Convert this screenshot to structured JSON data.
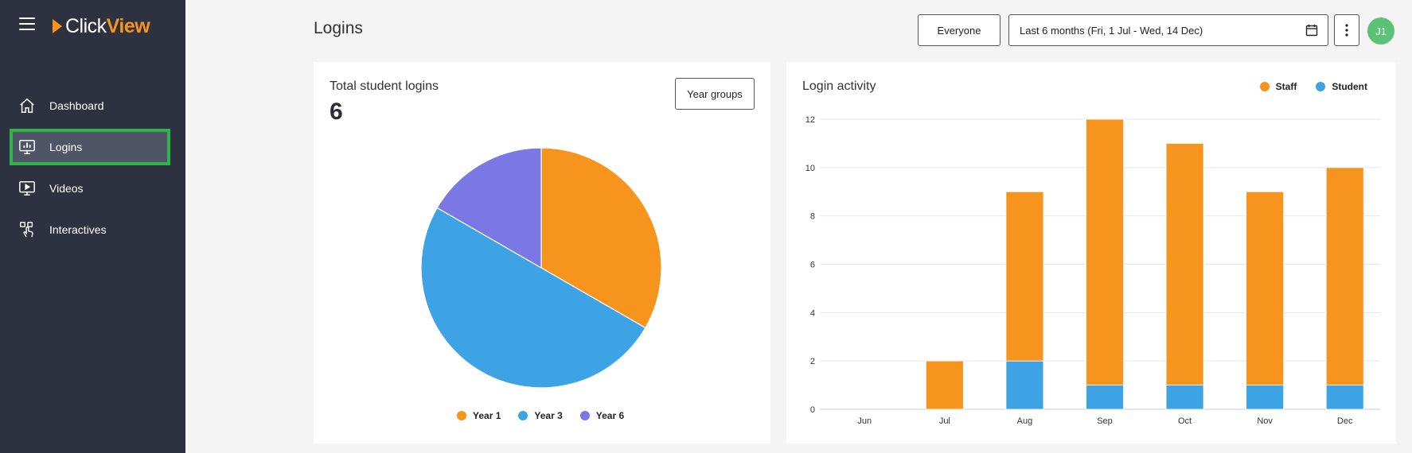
{
  "app": {
    "logo_click": "Click",
    "logo_view": "View"
  },
  "sidebar": {
    "items": [
      {
        "label": "Dashboard",
        "icon": "home-icon"
      },
      {
        "label": "Logins",
        "icon": "monitor-chart-icon",
        "active": true
      },
      {
        "label": "Videos",
        "icon": "video-play-icon"
      },
      {
        "label": "Interactives",
        "icon": "touch-hand-icon"
      }
    ]
  },
  "header": {
    "title": "Logins",
    "audience_label": "Everyone",
    "date_range": "Last 6 months (Fri, 1 Jul - Wed, 14 Dec)",
    "avatar_initials": "J1"
  },
  "colors": {
    "staff": "#f7941d",
    "student": "#3ea3e5",
    "year1": "#f7941d",
    "year3": "#3ea3e5",
    "year6": "#7b77e5",
    "active_outline": "#2fb34a"
  },
  "total_logins": {
    "title": "Total student logins",
    "value": "6",
    "button_label": "Year groups"
  },
  "login_activity": {
    "title": "Login activity"
  },
  "chart_data": [
    {
      "type": "pie",
      "title": "Total student logins",
      "categories": [
        "Year 1",
        "Year 3",
        "Year 6"
      ],
      "values": [
        2,
        3,
        1
      ],
      "legend": "bottom"
    },
    {
      "type": "bar",
      "stacked": true,
      "title": "Login activity",
      "categories": [
        "Jun",
        "Jul",
        "Aug",
        "Sep",
        "Oct",
        "Nov",
        "Dec"
      ],
      "series": [
        {
          "name": "Student",
          "values": [
            0,
            0,
            2,
            1,
            1,
            1,
            1
          ]
        },
        {
          "name": "Staff",
          "values": [
            0,
            2,
            7,
            11,
            10,
            8,
            9
          ]
        }
      ],
      "ylim": [
        0,
        12
      ],
      "yticks": [
        0,
        2,
        4,
        6,
        8,
        10,
        12
      ],
      "grid": true,
      "legend": "top-right"
    }
  ]
}
